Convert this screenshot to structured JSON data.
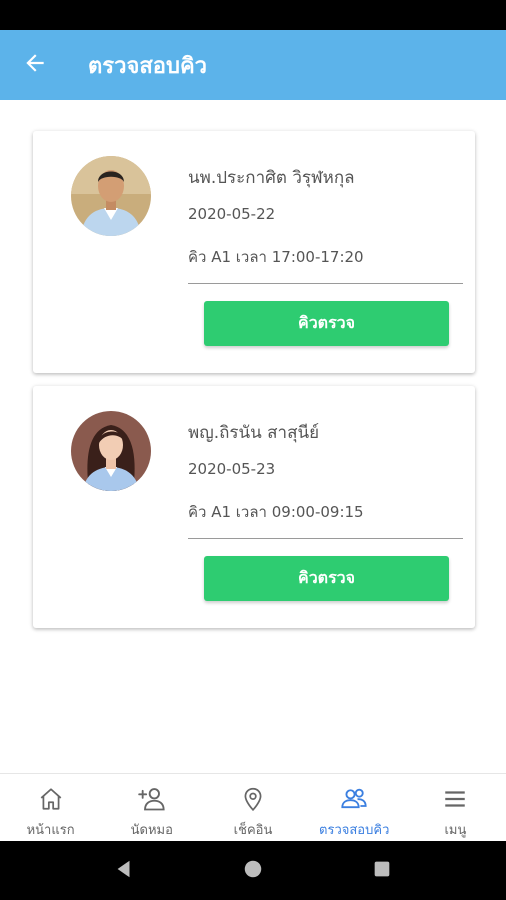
{
  "header": {
    "title": "ตรวจสอบคิว"
  },
  "appointments": [
    {
      "doctor_name": "นพ.ประกาศิต วิรุฬหกุล",
      "date": "2020-05-22",
      "queue": "คิว A1 เวลา 17:00-17:20",
      "button_label": "คิวตรวจ"
    },
    {
      "doctor_name": "พญ.ถิรนัน สาสุนีย์",
      "date": "2020-05-23",
      "queue": "คิว A1 เวลา 09:00-09:15",
      "button_label": "คิวตรวจ"
    }
  ],
  "bottom_nav": {
    "items": [
      {
        "label": "หน้าแรก",
        "icon": "home-icon"
      },
      {
        "label": "นัดหมอ",
        "icon": "add-user-icon"
      },
      {
        "label": "เช็คอิน",
        "icon": "location-pin-icon"
      },
      {
        "label": "ตรวจสอบคิว",
        "icon": "users-icon",
        "active": true
      },
      {
        "label": "เมนู",
        "icon": "menu-icon"
      }
    ]
  },
  "colors": {
    "header": "#5cb3ea",
    "button": "#2ecc71",
    "active_nav": "#3b7fe0"
  }
}
